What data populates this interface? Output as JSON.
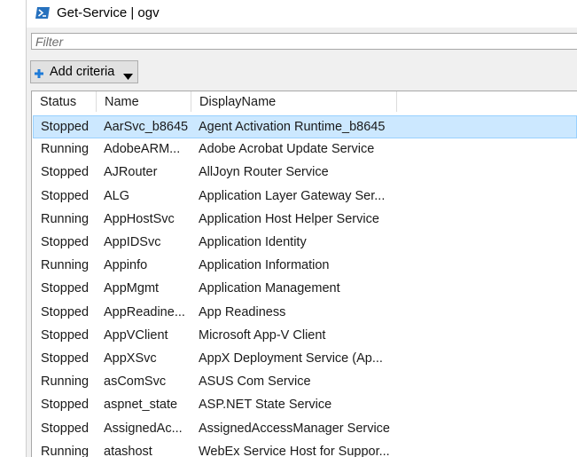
{
  "window": {
    "title": "Get-Service | ogv"
  },
  "filter": {
    "placeholder": "Filter"
  },
  "toolbar": {
    "add_criteria_label": "Add criteria"
  },
  "icons": {
    "app": "powershell-icon",
    "add": "plus-icon",
    "dropdown": "caret-down-icon"
  },
  "colors": {
    "selected_row_bg": "#cce8ff",
    "selected_row_border": "#99d1ff",
    "accent_plus": "#1e7bd8"
  },
  "grid": {
    "columns": [
      {
        "label": "Status"
      },
      {
        "label": "Name"
      },
      {
        "label": "DisplayName"
      }
    ],
    "selected_index": 0,
    "rows": [
      {
        "status": "Stopped",
        "name": "AarSvc_b8645",
        "display": "Agent Activation Runtime_b8645"
      },
      {
        "status": "Running",
        "name": "AdobeARM...",
        "display": "Adobe Acrobat Update Service"
      },
      {
        "status": "Stopped",
        "name": "AJRouter",
        "display": "AllJoyn Router Service"
      },
      {
        "status": "Stopped",
        "name": "ALG",
        "display": "Application Layer Gateway Ser..."
      },
      {
        "status": "Running",
        "name": "AppHostSvc",
        "display": "Application Host Helper Service"
      },
      {
        "status": "Stopped",
        "name": "AppIDSvc",
        "display": "Application Identity"
      },
      {
        "status": "Running",
        "name": "Appinfo",
        "display": "Application Information"
      },
      {
        "status": "Stopped",
        "name": "AppMgmt",
        "display": "Application Management"
      },
      {
        "status": "Stopped",
        "name": "AppReadine...",
        "display": "App Readiness"
      },
      {
        "status": "Stopped",
        "name": "AppVClient",
        "display": "Microsoft App-V Client"
      },
      {
        "status": "Stopped",
        "name": "AppXSvc",
        "display": "AppX Deployment Service (Ap..."
      },
      {
        "status": "Running",
        "name": "asComSvc",
        "display": "ASUS Com Service"
      },
      {
        "status": "Stopped",
        "name": "aspnet_state",
        "display": "ASP.NET State Service"
      },
      {
        "status": "Stopped",
        "name": "AssignedAc...",
        "display": "AssignedAccessManager Service"
      },
      {
        "status": "Running",
        "name": "atashost",
        "display": "WebEx Service Host for Suppor..."
      }
    ]
  }
}
